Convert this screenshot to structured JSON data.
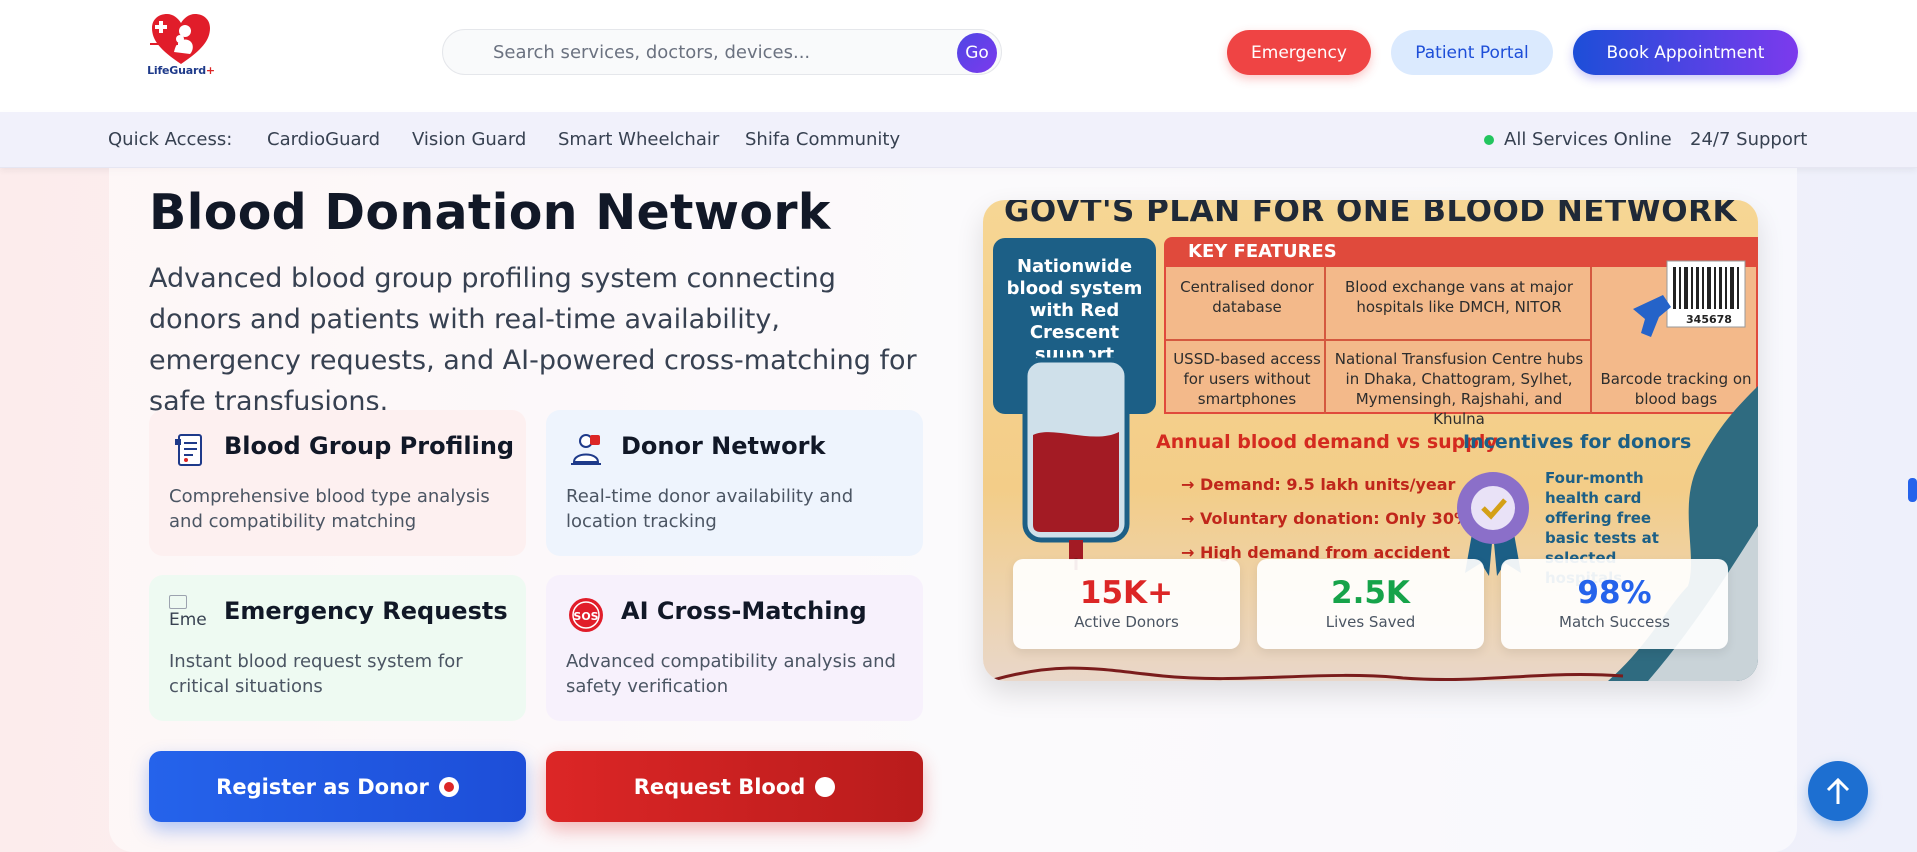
{
  "header": {
    "logo_text": "LifeGuard",
    "logo_plus": "+",
    "search_placeholder": "Search services, doctors, devices...",
    "search_go": "Go",
    "emergency": "Emergency",
    "patient_portal": "Patient Portal",
    "book_appointment": "Book Appointment"
  },
  "quickbar": {
    "label": "Quick Access:",
    "links": [
      "CardioGuard",
      "Vision Guard",
      "Smart Wheelchair",
      "Shifa Community"
    ],
    "status": "All Services Online",
    "support": "24/7 Support"
  },
  "main": {
    "title": "Blood Donation Network",
    "description": "Advanced blood group profiling system connecting donors and patients with real-time availability, emergency requests, and AI-powered cross-matching for safe transfusions.",
    "cards": [
      {
        "title": "Blood Group Profiling",
        "text": "Comprehensive blood type analysis and compatibility matching",
        "icon": "profile-document-icon"
      },
      {
        "title": "Donor Network",
        "text": "Real-time donor availability and location tracking",
        "icon": "donor-network-icon"
      },
      {
        "title": "Emergency Requests",
        "text": "Instant blood request system for critical situations",
        "icon": "broken-image-icon",
        "alt": "Eme"
      },
      {
        "title": "AI Cross-Matching",
        "text": "Advanced compatibility analysis and safety verification",
        "icon": "sos-icon",
        "icon_text": "SOS"
      }
    ],
    "register_button": "Register as Donor",
    "request_button": "Request Blood"
  },
  "infographic": {
    "title": "GOVT'S PLAN FOR ONE BLOOD NETWORK",
    "left_box": "Nationwide blood system with Red Crescent support",
    "key_features": "KEY FEATURES",
    "features": [
      "Centralised donor database",
      "Blood exchange vans at major hospitals like DMCH, NITOR",
      "USSD-based access for users without smartphones",
      "National Transfusion Centre hubs in Dhaka, Chattogram, Sylhet, Mymensingh, Rajshahi, and Khulna",
      "Barcode tracking on blood bags"
    ],
    "barcode_number": "345678",
    "demand_title": "Annual blood demand vs supply",
    "demand_items": [
      "Demand: 9.5 lakh units/year",
      "Voluntary donation: Only 30%",
      "High demand from accident"
    ],
    "incentives_title": "Incentives for donors",
    "incentives_text": "Four-month health card offering free basic tests at selected hospitals"
  },
  "stats": [
    {
      "value": "15K+",
      "label": "Active Donors",
      "color": "#dc2626"
    },
    {
      "value": "2.5K",
      "label": "Lives Saved",
      "color": "#16a34a"
    },
    {
      "value": "98%",
      "label": "Match Success",
      "color": "#2563eb"
    }
  ],
  "colors": {
    "primary_blue": "#2563eb",
    "emergency_red": "#ef4444",
    "accent_purple": "#7c3aed"
  }
}
